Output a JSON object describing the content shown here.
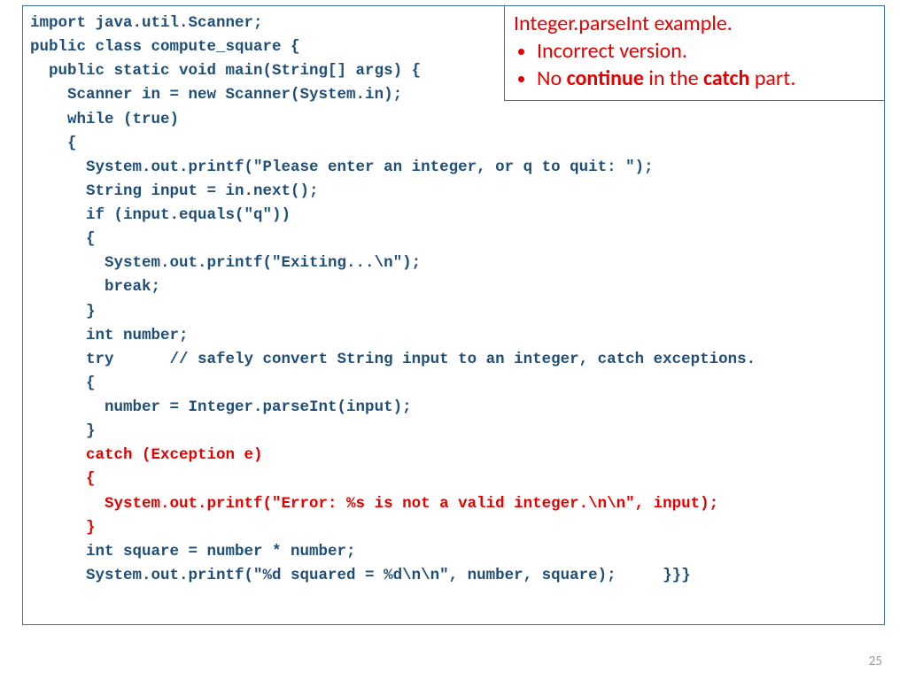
{
  "note": {
    "title": "Integer.parseInt example.",
    "items": [
      {
        "prefix": "Incorrect version.",
        "bold": ""
      },
      {
        "prefix": "No ",
        "mid1": "continue",
        "mid2": " in the ",
        "mid3": "catch",
        "suffix": " part."
      }
    ]
  },
  "code": {
    "l01": "import java.util.Scanner;",
    "l02": "public class compute_square {",
    "l03": "  public static void main(String[] args) {",
    "l04": "    Scanner in = new Scanner(System.in);",
    "l05": "    while (true)",
    "l06": "    {",
    "l07": "      System.out.printf(\"Please enter an integer, or q to quit: \");",
    "l08": "      String input = in.next();",
    "l09": "      if (input.equals(\"q\"))",
    "l10": "      {",
    "l11": "        System.out.printf(\"Exiting...\\n\");",
    "l12": "        break;",
    "l13": "      }",
    "l14": "      int number;",
    "l15": "      try      // safely convert String input to an integer, catch exceptions.",
    "l16": "      {",
    "l17": "        number = Integer.parseInt(input);",
    "l18": "      }",
    "l19": "      catch (Exception e)",
    "l20": "      {",
    "l21": "        System.out.printf(\"Error: %s is not a valid integer.\\n\\n\", input);",
    "l22": "      }",
    "l23": "      int square = number * number;",
    "l24": "      System.out.printf(\"%d squared = %d\\n\\n\", number, square);     }}}"
  },
  "page": "25"
}
